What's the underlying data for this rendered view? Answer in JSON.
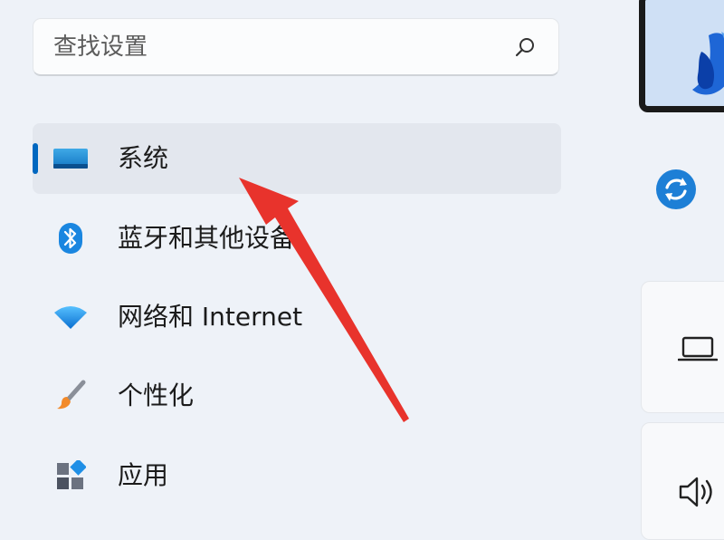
{
  "search": {
    "placeholder": "查找设置",
    "icon": "search-icon"
  },
  "nav": {
    "items": [
      {
        "label": "系统",
        "icon": "monitor-icon",
        "selected": true
      },
      {
        "label": "蓝牙和其他设备",
        "icon": "bluetooth-icon"
      },
      {
        "label": "网络和 Internet",
        "icon": "wifi-icon"
      },
      {
        "label": "个性化",
        "icon": "paintbrush-icon"
      },
      {
        "label": "应用",
        "icon": "apps-icon"
      }
    ]
  },
  "right_panel": {
    "icons": [
      "refresh-icon",
      "laptop-icon",
      "speaker-icon"
    ]
  },
  "colors": {
    "accent": "#0067c0",
    "annotation_arrow": "#e8332c",
    "background": "#eef2f8"
  }
}
